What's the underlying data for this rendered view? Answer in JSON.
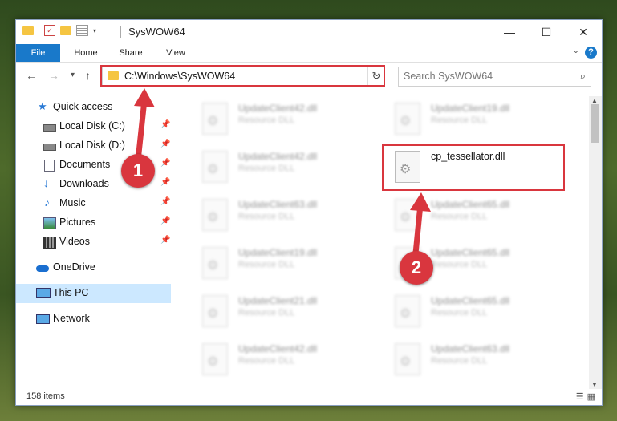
{
  "window": {
    "title": "SysWOW64"
  },
  "ribbon": {
    "tabs": [
      "File",
      "Home",
      "Share",
      "View"
    ],
    "help": "?"
  },
  "window_controls": {
    "minimize": "—",
    "maximize": "☐",
    "close": "✕"
  },
  "nav": {
    "back": "←",
    "forward": "→",
    "recent": "▾",
    "up": "↑"
  },
  "address": {
    "path": "C:\\Windows\\SysWOW64",
    "dropdown": "⌄",
    "refresh": "↻"
  },
  "search": {
    "placeholder": "Search SysWOW64",
    "icon": "search-icon"
  },
  "sidebar": {
    "items": [
      {
        "label": "Quick access",
        "icon": "star-icon"
      },
      {
        "label": "Local Disk (C:)",
        "icon": "drive-icon"
      },
      {
        "label": "Local Disk (D:)",
        "icon": "drive-icon"
      },
      {
        "label": "Documents",
        "icon": "documents-icon"
      },
      {
        "label": "Downloads",
        "icon": "downloads-icon"
      },
      {
        "label": "Music",
        "icon": "music-icon"
      },
      {
        "label": "Pictures",
        "icon": "pictures-icon"
      },
      {
        "label": "Videos",
        "icon": "videos-icon"
      },
      {
        "label": "OneDrive",
        "icon": "cloud-icon"
      },
      {
        "label": "This PC",
        "icon": "computer-icon"
      },
      {
        "label": "Network",
        "icon": "network-icon"
      }
    ]
  },
  "files": {
    "left": [
      {
        "name": "UpdateClient42.dll",
        "type": "Resource DLL"
      },
      {
        "name": "UpdateClient42.dll",
        "type": "Resource DLL"
      },
      {
        "name": "UpdateClient63.dll",
        "type": "Resource DLL"
      },
      {
        "name": "UpdateClient19.dll",
        "type": "Resource DLL"
      },
      {
        "name": "UpdateClient21.dll",
        "type": "Resource DLL"
      },
      {
        "name": "UpdateClient42.dll",
        "type": "Resource DLL"
      }
    ],
    "right": [
      {
        "name": "UpdateClient19.dll",
        "type": "Resource DLL"
      },
      {
        "name": "cp_tessellator.dll",
        "type": ""
      },
      {
        "name": "UpdateClient65.dll",
        "type": "Resource DLL"
      },
      {
        "name": "UpdateClient65.dll",
        "type": "Resource DLL"
      },
      {
        "name": "UpdateClient65.dll",
        "type": "Resource DLL"
      },
      {
        "name": "UpdateClient63.dll",
        "type": "Resource DLL"
      }
    ]
  },
  "status": {
    "item_count": "158 items"
  },
  "annotations": {
    "step1": "1",
    "step2": "2",
    "color": "#d9363e"
  }
}
